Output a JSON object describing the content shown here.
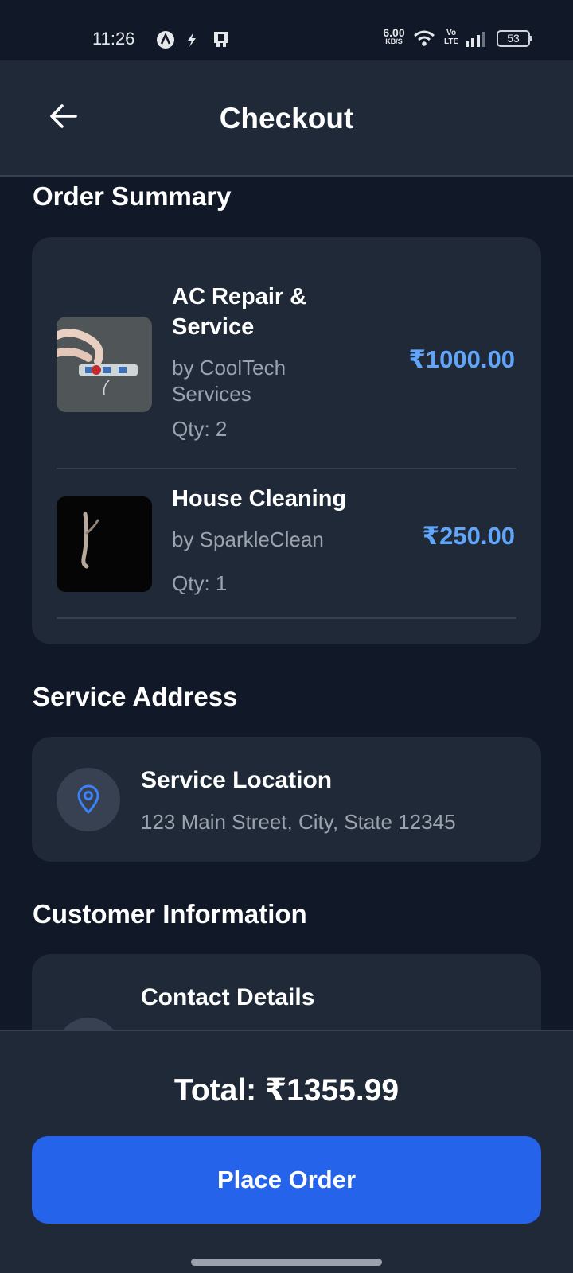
{
  "status_bar": {
    "time": "11:26",
    "net_speed_value": "6.00",
    "net_speed_unit": "KB/S",
    "volte_top": "Vo",
    "volte_bottom": "LTE",
    "battery": "53"
  },
  "header": {
    "title": "Checkout",
    "back_icon": "arrow-left-icon"
  },
  "order_summary": {
    "title": "Order Summary",
    "items": [
      {
        "name": "AC Repair & Service",
        "by": "by CoolTech Services",
        "qty": "Qty: 2",
        "price": "₹1000.00"
      },
      {
        "name": "House Cleaning",
        "by": "by SparkleClean",
        "qty": "Qty: 1",
        "price": "₹250.00"
      }
    ]
  },
  "service_address": {
    "title": "Service Address",
    "label": "Service Location",
    "address": "123 Main Street, City, State 12345",
    "icon": "location-pin-icon"
  },
  "customer_info": {
    "title": "Customer Information",
    "label": "Contact Details"
  },
  "footer": {
    "total": "Total: ₹1355.99",
    "place_order": "Place Order"
  },
  "colors": {
    "background": "#111827",
    "surface": "#1f2937",
    "accent": "#2563eb",
    "price": "#60a5fa"
  }
}
